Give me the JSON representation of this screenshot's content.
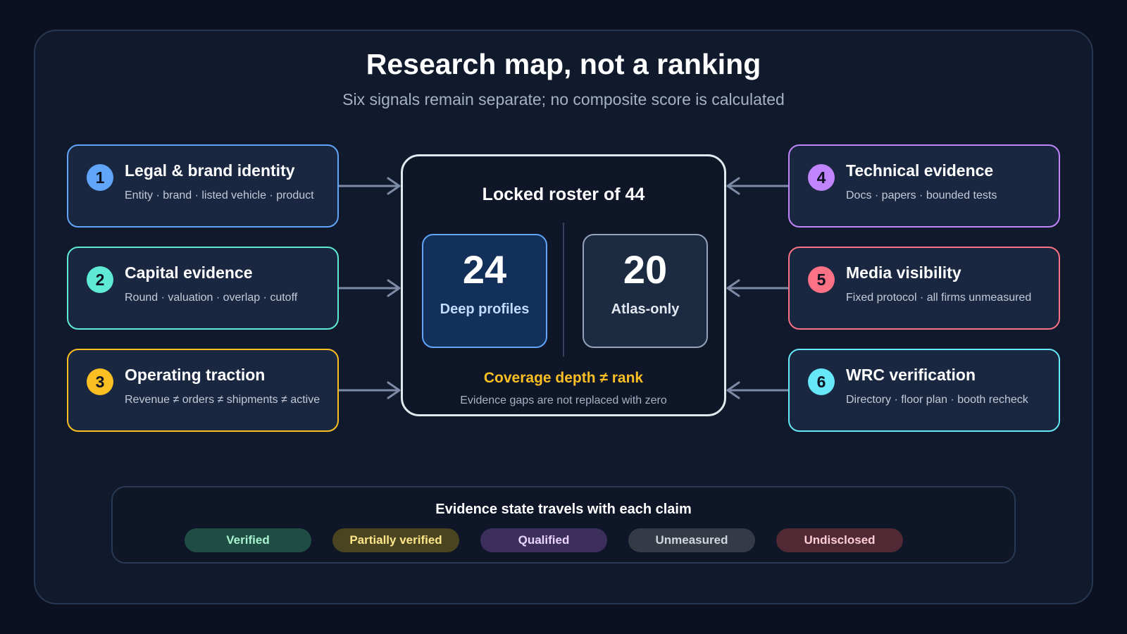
{
  "header": {
    "title": "Research map, not a ranking",
    "subtitle": "Six signals remain separate; no composite score is calculated"
  },
  "signals": [
    {
      "number": "1",
      "title": "Legal & brand identity",
      "detail": "Entity · brand · listed vehicle · product",
      "color": "#60a5fa"
    },
    {
      "number": "2",
      "title": "Capital evidence",
      "detail": "Round · valuation · overlap · cutoff",
      "color": "#5eead4"
    },
    {
      "number": "3",
      "title": "Operating traction",
      "detail": "Revenue ≠ orders ≠ shipments ≠ active",
      "color": "#fbbf24"
    },
    {
      "number": "4",
      "title": "Technical evidence",
      "detail": "Docs · papers · bounded tests",
      "color": "#c084fc"
    },
    {
      "number": "5",
      "title": "Media visibility",
      "detail": "Fixed protocol · all firms unmeasured",
      "color": "#fb7185"
    },
    {
      "number": "6",
      "title": "WRC verification",
      "detail": "Directory · floor plan · booth recheck",
      "color": "#67e8f9"
    }
  ],
  "roster": {
    "title": "Locked roster of 44",
    "deep": {
      "value": "24",
      "label": "Deep profiles"
    },
    "atlas": {
      "value": "20",
      "label": "Atlas-only"
    },
    "note": "Coverage depth ≠ rank",
    "subnote": "Evidence gaps are not replaced with zero"
  },
  "legend": {
    "title": "Evidence state travels with each claim",
    "states": [
      {
        "label": "Verified",
        "bg": "#1f4d43",
        "fg": "#a7f3d0"
      },
      {
        "label": "Partially verified",
        "bg": "#4a4420",
        "fg": "#fde68a"
      },
      {
        "label": "Qualified",
        "bg": "#3d2f5c",
        "fg": "#e9d5ff"
      },
      {
        "label": "Unmeasured",
        "bg": "#343b47",
        "fg": "#d1d5db"
      },
      {
        "label": "Undisclosed",
        "bg": "#4f2a35",
        "fg": "#fecdd3"
      }
    ]
  },
  "colors": {
    "arrow": "#7c8aa5",
    "deep_border": "#60a5fa",
    "atlas_border": "#94a3b8"
  }
}
